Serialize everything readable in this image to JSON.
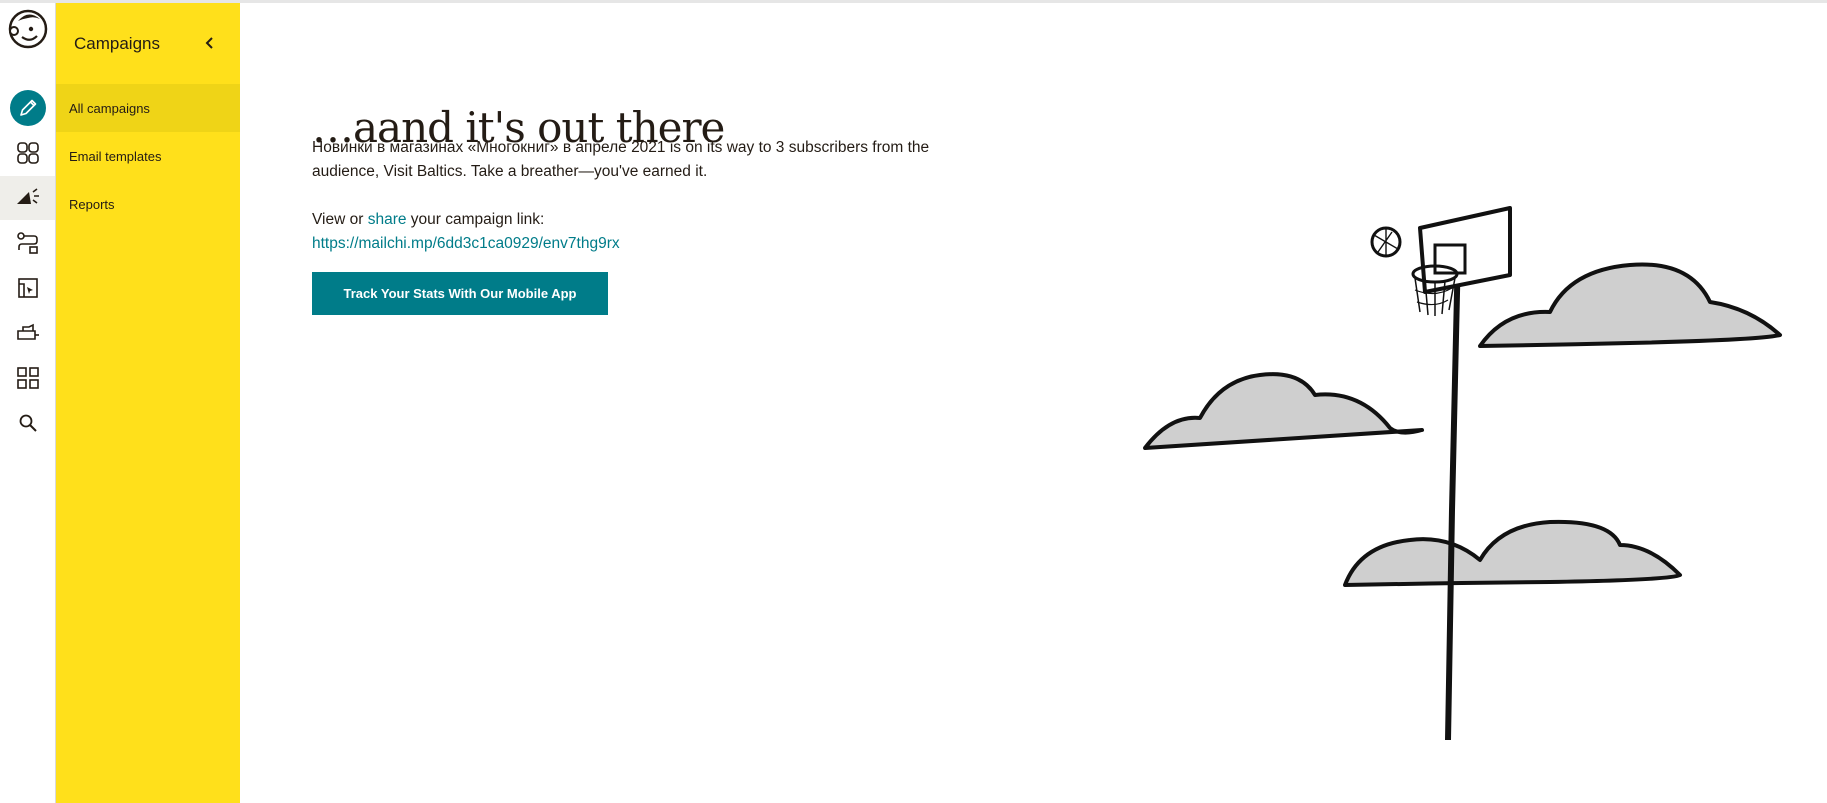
{
  "app": {
    "logo": "mailchimp-freddie-logo"
  },
  "rail": {
    "items": [
      {
        "icon": "pencil-create-icon",
        "label": "Create"
      },
      {
        "icon": "audience-icon",
        "label": "Audience"
      },
      {
        "icon": "megaphone-campaigns-icon",
        "label": "Campaigns",
        "active": true
      },
      {
        "icon": "automations-icon",
        "label": "Automations"
      },
      {
        "icon": "website-icon",
        "label": "Website"
      },
      {
        "icon": "content-studio-icon",
        "label": "Content"
      },
      {
        "icon": "integrations-grid-icon",
        "label": "Integrations"
      },
      {
        "icon": "search-icon",
        "label": "Search"
      }
    ]
  },
  "panel": {
    "title": "Campaigns",
    "items": [
      {
        "label": "All campaigns",
        "selected": true
      },
      {
        "label": "Email templates"
      },
      {
        "label": "Reports"
      }
    ]
  },
  "main": {
    "headline": "…aand it's out there",
    "message": "Новинки в магазинах «Многокниг» в апреле 2021 is on its way to 3 subscribers from the audience, Visit Baltics. Take a breather—you've earned it.",
    "link_prefix": "View or ",
    "share_label": "share",
    "link_suffix": " your campaign link:",
    "campaign_url": "https://mailchi.mp/6dd3c1ca0929/env7thg9rx",
    "cta_label": "Track Your Stats With Our Mobile App"
  },
  "colors": {
    "accent_teal": "#007c89",
    "panel_yellow": "#ffe01b",
    "panel_selected": "#efd417"
  }
}
